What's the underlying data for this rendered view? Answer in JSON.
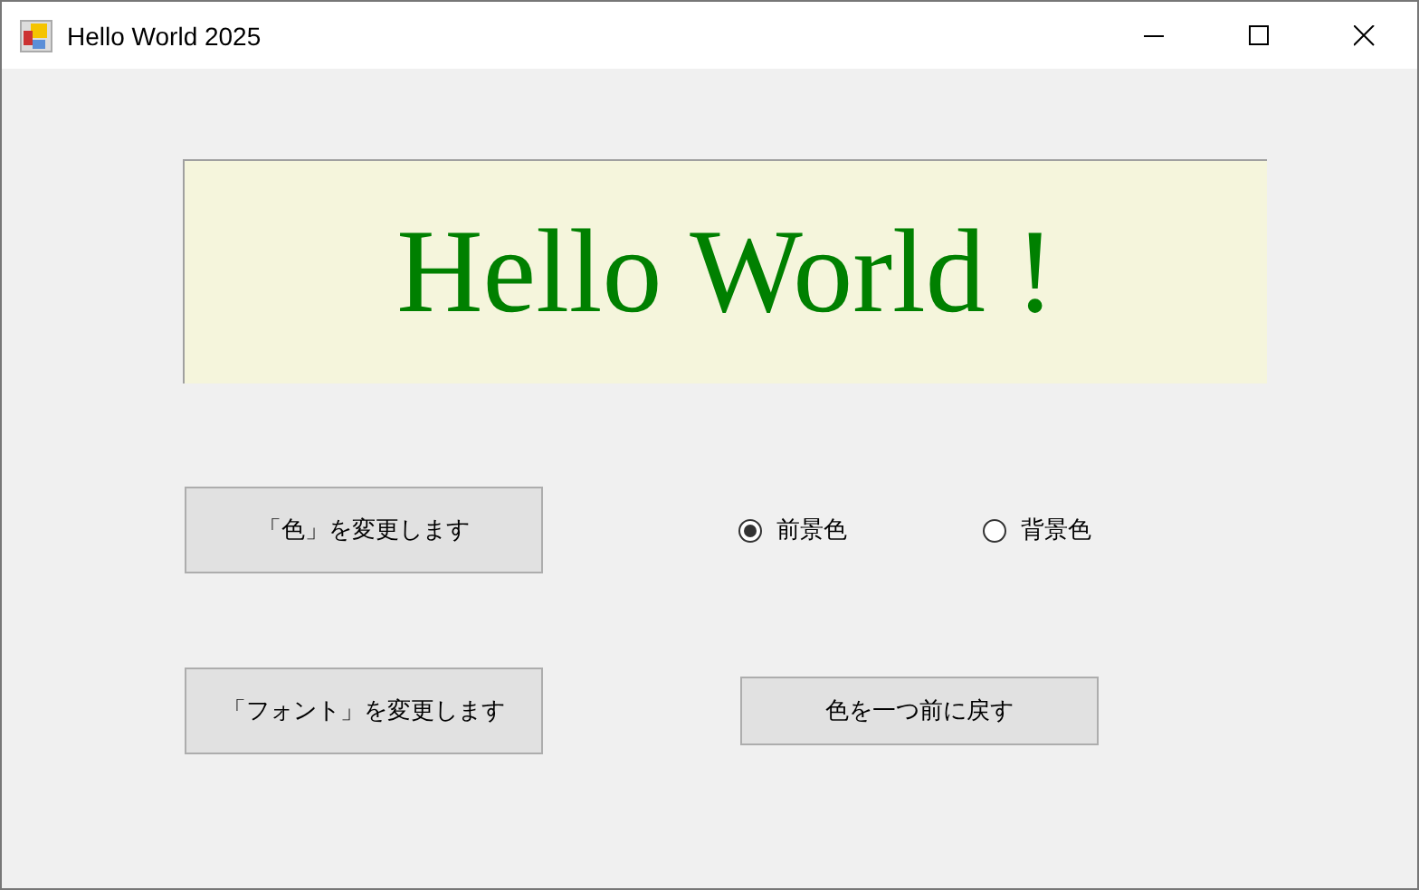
{
  "window": {
    "title": "Hello World 2025"
  },
  "display": {
    "text": "Hello World !"
  },
  "color_button": {
    "label": "「色」を変更します"
  },
  "radios": [
    {
      "label": "前景色",
      "selected": true
    },
    {
      "label": "背景色",
      "selected": false
    }
  ],
  "font_button": {
    "label": "「フォント」を変更します"
  },
  "undo_button": {
    "label": "色を一つ前に戻す"
  }
}
